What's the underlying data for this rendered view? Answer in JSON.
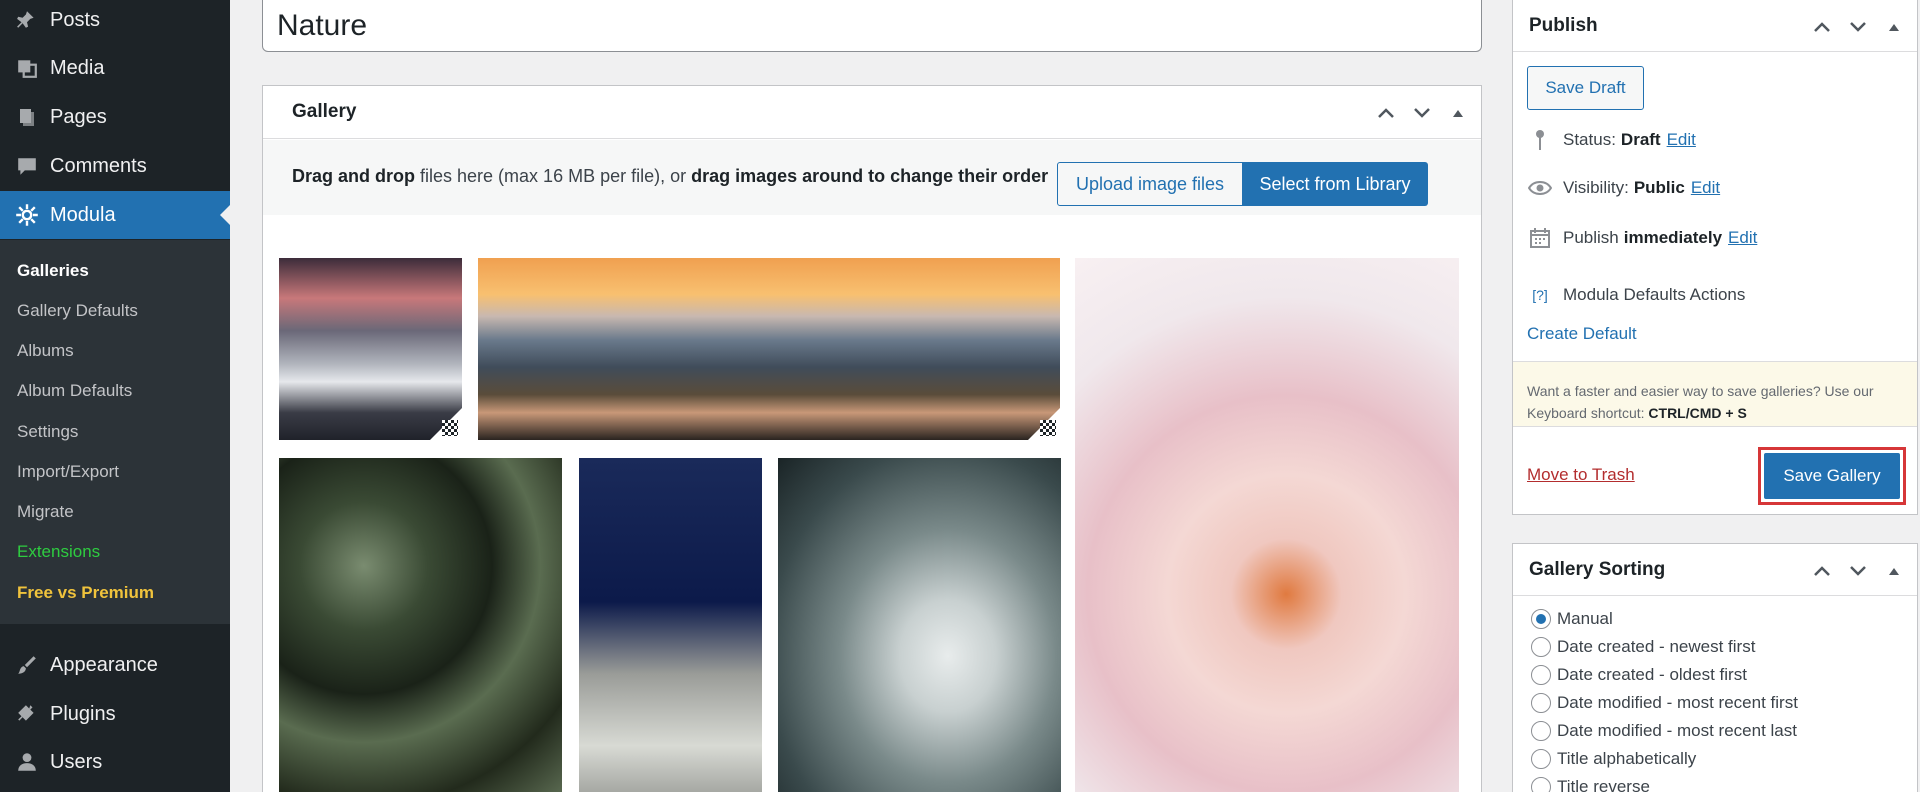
{
  "sidebar": {
    "items": [
      {
        "label": "Posts",
        "icon": "pin-icon"
      },
      {
        "label": "Media",
        "icon": "media-icon"
      },
      {
        "label": "Pages",
        "icon": "pages-icon"
      },
      {
        "label": "Comments",
        "icon": "comments-icon"
      },
      {
        "label": "Modula",
        "icon": "gear-icon",
        "active": true
      },
      {
        "label": "Appearance",
        "icon": "paintbrush-icon"
      },
      {
        "label": "Plugins",
        "icon": "plugin-icon"
      },
      {
        "label": "Users",
        "icon": "user-icon"
      }
    ],
    "submenu": [
      "Galleries",
      "Gallery Defaults",
      "Albums",
      "Album Defaults",
      "Settings",
      "Import/Export",
      "Migrate",
      "Extensions",
      "Free vs Premium"
    ]
  },
  "title": "Nature",
  "gallery": {
    "heading": "Gallery",
    "drag_bold_1": "Drag and drop",
    "drag_mid": " files here (max 16 MB per file), or ",
    "drag_bold_2": "drag images around to change their order",
    "upload_label": "Upload image files",
    "library_label": "Select from Library"
  },
  "publish": {
    "heading": "Publish",
    "save_draft": "Save Draft",
    "status_label": "Status:",
    "status_value": "Draft",
    "visibility_label": "Visibility:",
    "visibility_value": "Public",
    "publish_label": "Publish",
    "publish_value": "immediately",
    "edit": "Edit",
    "defaults_icon_text": "[?]",
    "defaults_actions": "Modula Defaults Actions",
    "create_default": "Create Default",
    "shortcut_text": "Want a faster and easier way to save galleries? Use our Keyboard shortcut:",
    "shortcut_keys": "CTRL/CMD + S",
    "trash": "Move to Trash",
    "save_gallery": "Save Gallery"
  },
  "sorting": {
    "heading": "Gallery Sorting",
    "options": [
      "Manual",
      "Date created - newest first",
      "Date created - oldest first",
      "Date modified - most recent first",
      "Date modified - most recent last",
      "Title alphabetically",
      "Title reverse"
    ],
    "selected": "Manual"
  },
  "colors": {
    "accent": "#2271b1",
    "sidebar": "#1d2327",
    "highlight": "#d63638"
  }
}
